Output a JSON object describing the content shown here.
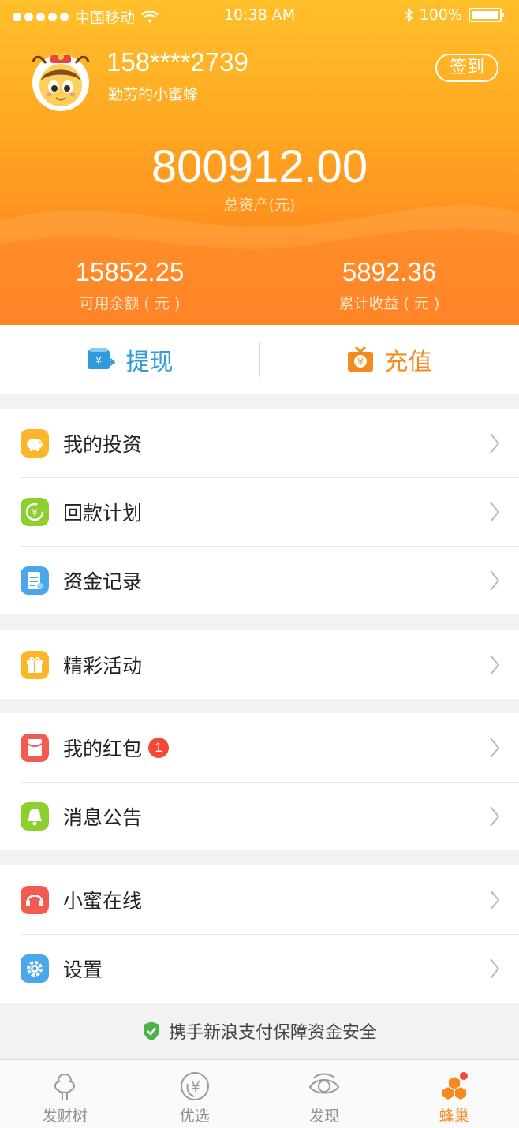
{
  "status_bar": {
    "carrier": "中国移动",
    "time": "10:38  AM",
    "battery": "100%"
  },
  "profile": {
    "phone": "158****2739",
    "nickname": "勤劳的小蜜蜂",
    "signin_label": "签到"
  },
  "assets": {
    "total_value": "800912.00",
    "total_label": "总资产(元)",
    "available_value": "15852.25",
    "available_label": "可用余额 ( 元 )",
    "earnings_value": "5892.36",
    "earnings_label": "累计收益 ( 元 )"
  },
  "actions": {
    "withdraw_label": "提现",
    "recharge_label": "充值"
  },
  "menu": {
    "my_investment": "我的投资",
    "repayment_plan": "回款计划",
    "fund_records": "资金记录",
    "activities": "精彩活动",
    "red_packets": "我的红包",
    "red_packets_badge": "1",
    "notices": "消息公告",
    "online_service": "小蜜在线",
    "settings": "设置"
  },
  "security_note": "携手新浪支付保障资金安全",
  "tabs": {
    "tab1": "发财树",
    "tab2": "优选",
    "tab3": "发现",
    "tab4": "蜂巢"
  },
  "colors": {
    "accent_orange": "#f58a1f",
    "header_top": "#ffc02a",
    "header_bottom": "#ff7e1b",
    "blue": "#2f9bdc",
    "badge_red": "#f4483b"
  }
}
